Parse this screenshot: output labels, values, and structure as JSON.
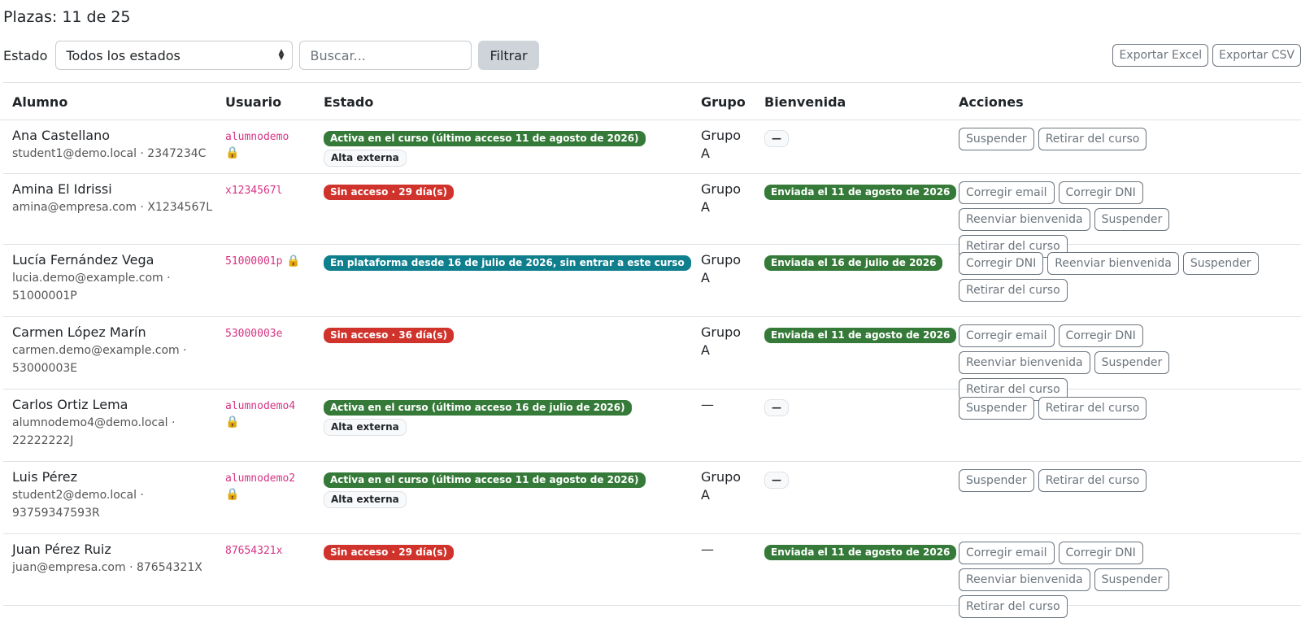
{
  "seats_label": "Plazas: 11 de 25",
  "filters": {
    "estado_label": "Estado",
    "estado_selected": "Todos los estados",
    "search_placeholder": "Buscar...",
    "filter_button": "Filtrar"
  },
  "exports": {
    "excel": "Exportar Excel",
    "csv": "Exportar CSV"
  },
  "columns": [
    "Alumno",
    "Usuario",
    "Estado",
    "Grupo",
    "Bienvenida",
    "Acciones"
  ],
  "rows": [
    {
      "name": "Ana Castellano",
      "contact": [
        "student1@demo.local · 2347234C"
      ],
      "username": "alumnodemo",
      "lock": true,
      "lock_inline": false,
      "status": {
        "text": "Activa en el curso (último acceso 11 de agosto de 2026)",
        "color": "green"
      },
      "extra": "Alta externa",
      "group": [
        "Grupo",
        "A"
      ],
      "welcome": {
        "text": "—",
        "type": "light"
      },
      "actions": [
        "Suspender",
        "Retirar del curso"
      ]
    },
    {
      "name": "Amina El Idrissi",
      "contact": [
        "amina@empresa.com · X1234567L"
      ],
      "username": "x1234567l",
      "lock": false,
      "lock_inline": false,
      "status": {
        "text": "Sin acceso · 29 día(s)",
        "color": "red"
      },
      "extra": "",
      "group": [
        "Grupo",
        "A"
      ],
      "welcome": {
        "text": "Enviada el 11 de agosto de 2026",
        "type": "green"
      },
      "actions": [
        "Corregir email",
        "Corregir DNI",
        "Reenviar bienvenida",
        "Suspender",
        "Retirar del curso"
      ]
    },
    {
      "name": "Lucía Fernández Vega",
      "contact": [
        "lucia.demo@example.com ·",
        "51000001P"
      ],
      "username": "51000001p",
      "lock": true,
      "lock_inline": true,
      "status": {
        "text": "En plataforma desde 16 de julio de 2026, sin entrar a este curso",
        "color": "teal"
      },
      "extra": "",
      "group": [
        "Grupo",
        "A"
      ],
      "welcome": {
        "text": "Enviada el 16 de julio de 2026",
        "type": "green"
      },
      "actions": [
        "Corregir DNI",
        "Reenviar bienvenida",
        "Suspender",
        "Retirar del curso"
      ]
    },
    {
      "name": "Carmen López Marín",
      "contact": [
        "carmen.demo@example.com ·",
        "53000003E"
      ],
      "username": "53000003e",
      "lock": false,
      "lock_inline": false,
      "status": {
        "text": "Sin acceso · 36 día(s)",
        "color": "red"
      },
      "extra": "",
      "group": [
        "Grupo",
        "A"
      ],
      "welcome": {
        "text": "Enviada el 11 de agosto de 2026",
        "type": "green"
      },
      "actions": [
        "Corregir email",
        "Corregir DNI",
        "Reenviar bienvenida",
        "Suspender",
        "Retirar del curso"
      ]
    },
    {
      "name": "Carlos Ortiz Lema",
      "contact": [
        "alumnodemo4@demo.local ·",
        "22222222J"
      ],
      "username": "alumnodemo4",
      "lock": true,
      "lock_inline": false,
      "status": {
        "text": "Activa en el curso (último acceso 16 de julio de 2026)",
        "color": "green"
      },
      "extra": "Alta externa",
      "group": [
        "—",
        ""
      ],
      "welcome": {
        "text": "—",
        "type": "light"
      },
      "actions": [
        "Suspender",
        "Retirar del curso"
      ]
    },
    {
      "name": "Luis Pérez",
      "contact": [
        "student2@demo.local ·",
        "93759347593R"
      ],
      "username": "alumnodemo2",
      "lock": true,
      "lock_inline": false,
      "status": {
        "text": "Activa en el curso (último acceso 11 de agosto de 2026)",
        "color": "green"
      },
      "extra": "Alta externa",
      "group": [
        "Grupo",
        "A"
      ],
      "welcome": {
        "text": "—",
        "type": "light"
      },
      "actions": [
        "Suspender",
        "Retirar del curso"
      ]
    },
    {
      "name": "Juan Pérez Ruiz",
      "contact": [
        "juan@empresa.com · 87654321X"
      ],
      "username": "87654321x",
      "lock": false,
      "lock_inline": false,
      "status": {
        "text": "Sin acceso · 29 día(s)",
        "color": "red"
      },
      "extra": "",
      "group": [
        "—",
        ""
      ],
      "welcome": {
        "text": "Enviada el 11 de agosto de 2026",
        "type": "green"
      },
      "actions": [
        "Corregir email",
        "Corregir DNI",
        "Reenviar bienvenida",
        "Suspender",
        "Retirar del curso"
      ]
    }
  ],
  "icons": {
    "lock": "lock-icon"
  },
  "colors": {
    "green": "#357a38",
    "red": "#d0332c",
    "teal": "#0f7f8e"
  }
}
